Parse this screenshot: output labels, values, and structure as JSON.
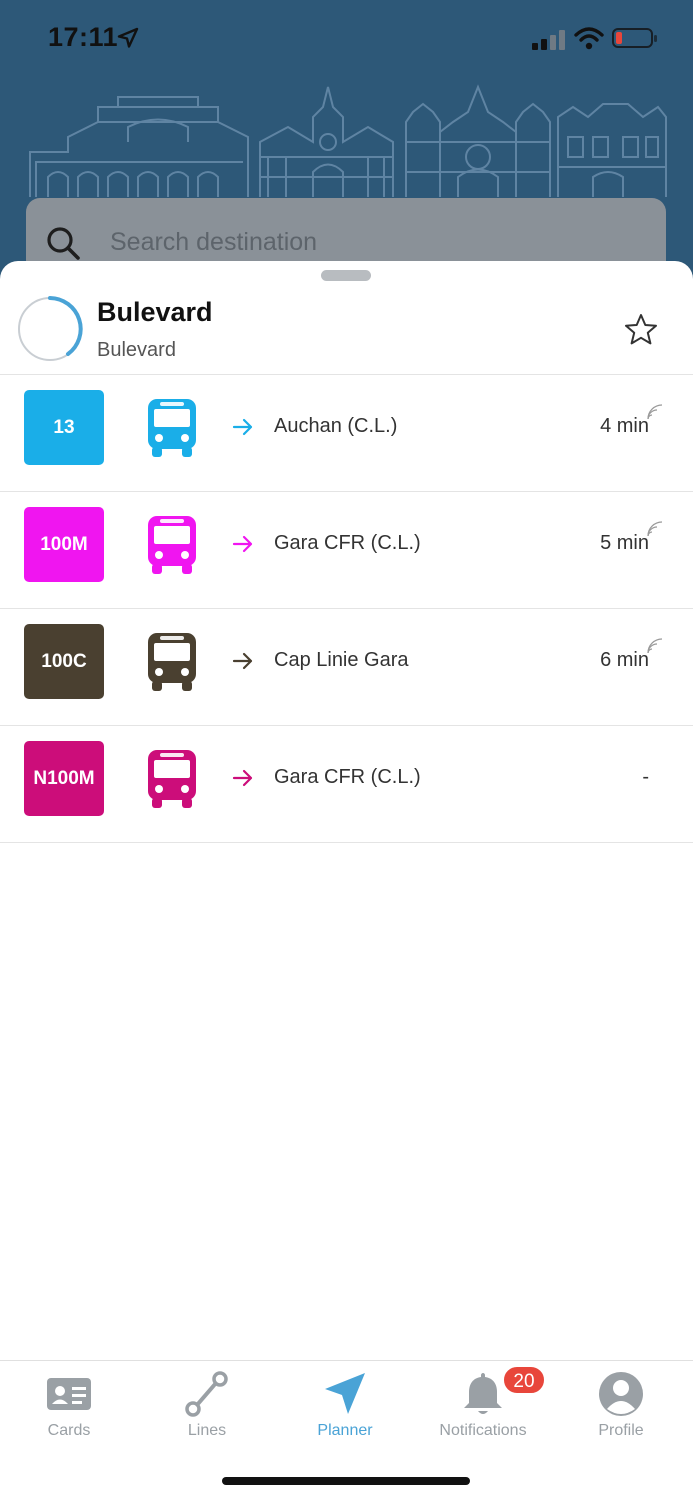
{
  "status_bar": {
    "time": "17:11"
  },
  "search": {
    "placeholder": "Search destination"
  },
  "stop": {
    "name": "Bulevard",
    "subtitle": "Bulevard"
  },
  "lines": [
    {
      "number": "13",
      "color": "#1aaee8",
      "destination": "Auchan (C.L.)",
      "eta": "4 min",
      "realtime": true
    },
    {
      "number": "100M",
      "color": "#f015f0",
      "destination": "Gara CFR (C.L.)",
      "eta": "5 min",
      "realtime": true
    },
    {
      "number": "100C",
      "color": "#4a4030",
      "destination": "Cap Linie Gara",
      "eta": "6 min",
      "realtime": true
    },
    {
      "number": "N100M",
      "color": "#cc0d7a",
      "destination": "Gara CFR (C.L.)",
      "eta": "-",
      "realtime": false
    }
  ],
  "tabs": [
    {
      "label": "Cards",
      "icon": "id-card-icon",
      "active": false
    },
    {
      "label": "Lines",
      "icon": "route-icon",
      "active": false
    },
    {
      "label": "Planner",
      "icon": "navigation-arrow-icon",
      "active": true
    },
    {
      "label": "Notifications",
      "icon": "bell-icon",
      "active": false,
      "badge": "20"
    },
    {
      "label": "Profile",
      "icon": "user-avatar-icon",
      "active": false
    }
  ],
  "colors": {
    "header_bg": "#2d5878",
    "accent": "#4aa3d6",
    "badge_red": "#e8463b"
  }
}
